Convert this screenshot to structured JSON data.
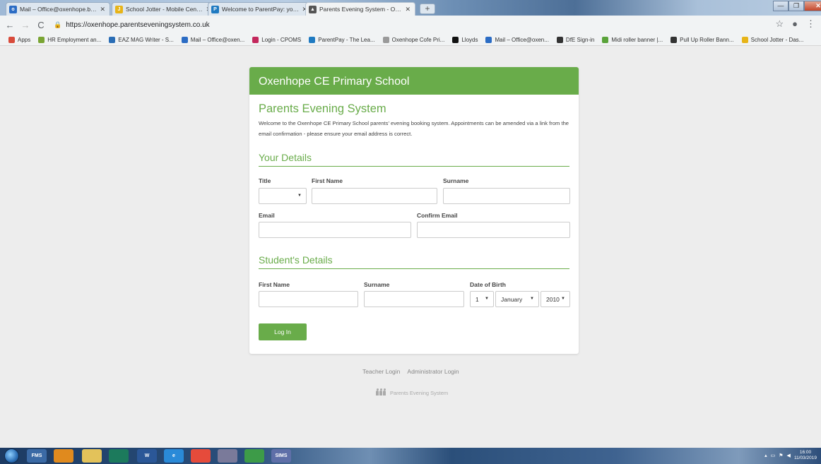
{
  "browser": {
    "tabs": [
      {
        "label": "Mail – Office@oxenhope.bradfo",
        "icon": "outlook-icon",
        "color": "#2b6cc4"
      },
      {
        "label": "School Jotter - Mobile Centre",
        "icon": "jotter-icon",
        "color": "#e7b418"
      },
      {
        "label": "Welcome to ParentPay: your onl",
        "icon": "parentpay-icon",
        "color": "#1f7ac1"
      },
      {
        "label": "Parents Evening System - Oxenh",
        "icon": "pes-icon",
        "color": "#555555",
        "active": true
      }
    ],
    "new_tab": "+",
    "url": "https://oxenhope.parentseveningsystem.co.uk",
    "bookmarks": [
      {
        "label": "Apps",
        "color": "#d84b3b"
      },
      {
        "label": "HR Employment an...",
        "color": "#7aa534"
      },
      {
        "label": "EAZ MAG Writer - S...",
        "color": "#2a6db5"
      },
      {
        "label": "Mail – Office@oxen...",
        "color": "#2b6cc4"
      },
      {
        "label": "Login - CPOMS",
        "color": "#c3275c"
      },
      {
        "label": "ParentPay - The Lea...",
        "color": "#1f7ac1"
      },
      {
        "label": "Oxenhope Cofe Pri...",
        "color": "#9a9a9a"
      },
      {
        "label": "Lloyds",
        "color": "#111111"
      },
      {
        "label": "Mail – Office@oxen...",
        "color": "#2b6cc4"
      },
      {
        "label": "DfE Sign-in",
        "color": "#333333"
      },
      {
        "label": "Midi roller banner |...",
        "color": "#5aa33a"
      },
      {
        "label": "Pull Up Roller Bann...",
        "color": "#333333"
      },
      {
        "label": "School Jotter - Das...",
        "color": "#e7b418"
      }
    ]
  },
  "page": {
    "school_name": "Oxenhope CE Primary School",
    "system_title": "Parents Evening System",
    "intro": "Welcome to the Oxenhope CE Primary School parents' evening booking system. Appointments can be amended via a link from the email confirmation - please ensure your email address is correct.",
    "your_details": {
      "heading": "Your Details",
      "title_label": "Title",
      "title_value": "",
      "first_name_label": "First Name",
      "surname_label": "Surname",
      "email_label": "Email",
      "confirm_email_label": "Confirm Email"
    },
    "student_details": {
      "heading": "Student's Details",
      "first_name_label": "First Name",
      "surname_label": "Surname",
      "dob_label": "Date of Birth",
      "dob_day": "1",
      "dob_month": "January",
      "dob_year": "2010"
    },
    "login_button": "Log In",
    "footer": {
      "teacher_login": "Teacher Login",
      "admin_login": "Administrator Login",
      "brand": "Parents Evening System"
    }
  },
  "taskbar": {
    "apps": [
      {
        "name": "fms-app",
        "label": "FMS",
        "color": "#3b6aa5"
      },
      {
        "name": "media-player-app",
        "label": "",
        "color": "#e08a1e"
      },
      {
        "name": "explorer-app",
        "label": "",
        "color": "#e3c25a"
      },
      {
        "name": "publisher-app",
        "label": "",
        "color": "#1c7a5c"
      },
      {
        "name": "word-app",
        "label": "W",
        "color": "#2b5797"
      },
      {
        "name": "ie-app",
        "label": "e",
        "color": "#2a8ad8"
      },
      {
        "name": "chrome-app",
        "label": "",
        "color": "#e64b3b"
      },
      {
        "name": "sims-app",
        "label": "",
        "color": "#7a7a9a"
      },
      {
        "name": "vpn-app",
        "label": "",
        "color": "#3d9b48"
      },
      {
        "name": "sims-net-app",
        "label": "SIMS",
        "color": "#5f6fa8"
      }
    ],
    "time": "16:00",
    "date": "11/03/2019"
  }
}
